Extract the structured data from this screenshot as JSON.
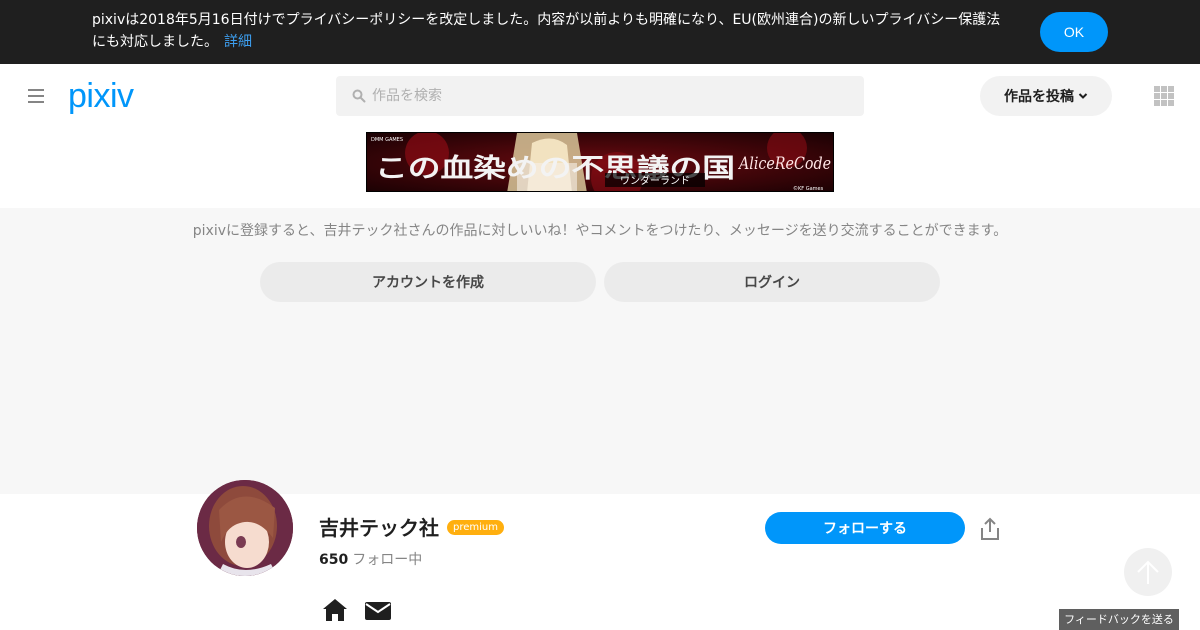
{
  "notice": {
    "text": "pixivは2018年5月16日付けでプライバシーポリシーを改定しました。内容が以前よりも明確になり、EU(欧州連合)の新しいプライバシー保護法にも対応しました。",
    "link": "詳細",
    "ok_label": "OK"
  },
  "header": {
    "logo": "pixiv",
    "search_placeholder": "作品を検索",
    "post_label": "作品を投稿"
  },
  "banner": {
    "title_main": "この血染めの不思議の国",
    "subtitle": "ワンダーランド",
    "brand": "AliceReCode",
    "publisher": "DMM GAMES",
    "copyright": "©KF Games"
  },
  "register": {
    "message": "pixivに登録すると、吉井テック社さんの作品に対しいいね！やコメントをつけたり、メッセージを送り交流することができます。",
    "create_account_label": "アカウントを作成",
    "login_label": "ログイン"
  },
  "profile": {
    "name": "吉井テック社",
    "badge": "premium",
    "following_count": "650",
    "following_label": "フォロー中",
    "follow_button": "フォローする"
  },
  "feedback_label": "フィードバックを送る",
  "colors": {
    "accent": "#0096fa",
    "notice_bg": "#1f1f1f",
    "premium": "#ffaf0f"
  }
}
